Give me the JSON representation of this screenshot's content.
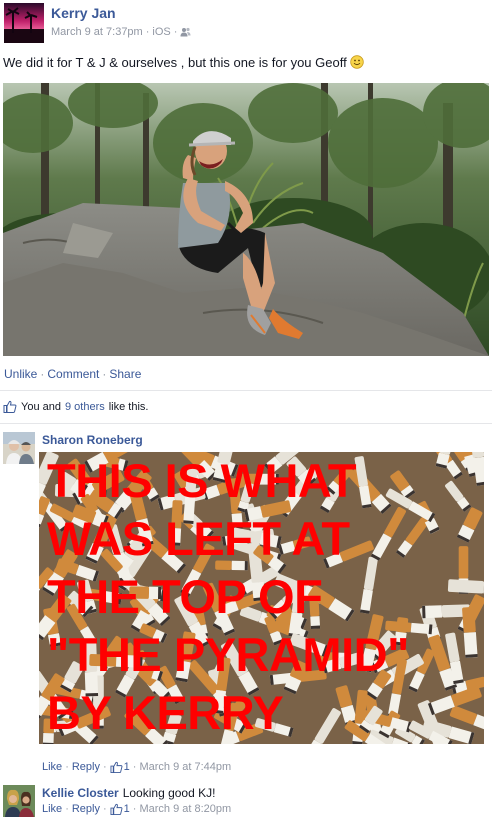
{
  "post": {
    "author": "Kerry Jan",
    "date": "March 9 at 7:37pm",
    "source": "iOS",
    "meta_sep": "·",
    "audience_icon": "friends-icon",
    "text": "We did it for T & J & ourselves , but this one is for you Geoff",
    "emoji": "smile-icon",
    "actions": {
      "unlike": "Unlike",
      "comment": "Comment",
      "share": "Share",
      "sep": "·"
    }
  },
  "likes": {
    "you_and": "You and",
    "others": "9 others",
    "like_this": "like this."
  },
  "comments": [
    {
      "author": "Sharon Roneberg",
      "text": "",
      "image_text": "THIS IS WHAT\nWAS LEFT AT\nTHE TOP OF\n\"THE PYRAMID\"\nBY KERRY",
      "like_label": "Like",
      "reply_label": "Reply",
      "like_count": "1",
      "time": "March 9 at 7:44pm"
    },
    {
      "author": "Kellie Closter",
      "text": "Looking good KJ!",
      "like_label": "Like",
      "reply_label": "Reply",
      "like_count": "1",
      "time": "March 9 at 8:20pm"
    }
  ],
  "colors": {
    "link": "#3b5998",
    "meta": "#9197a3",
    "overlay_text": "#ff0000"
  }
}
